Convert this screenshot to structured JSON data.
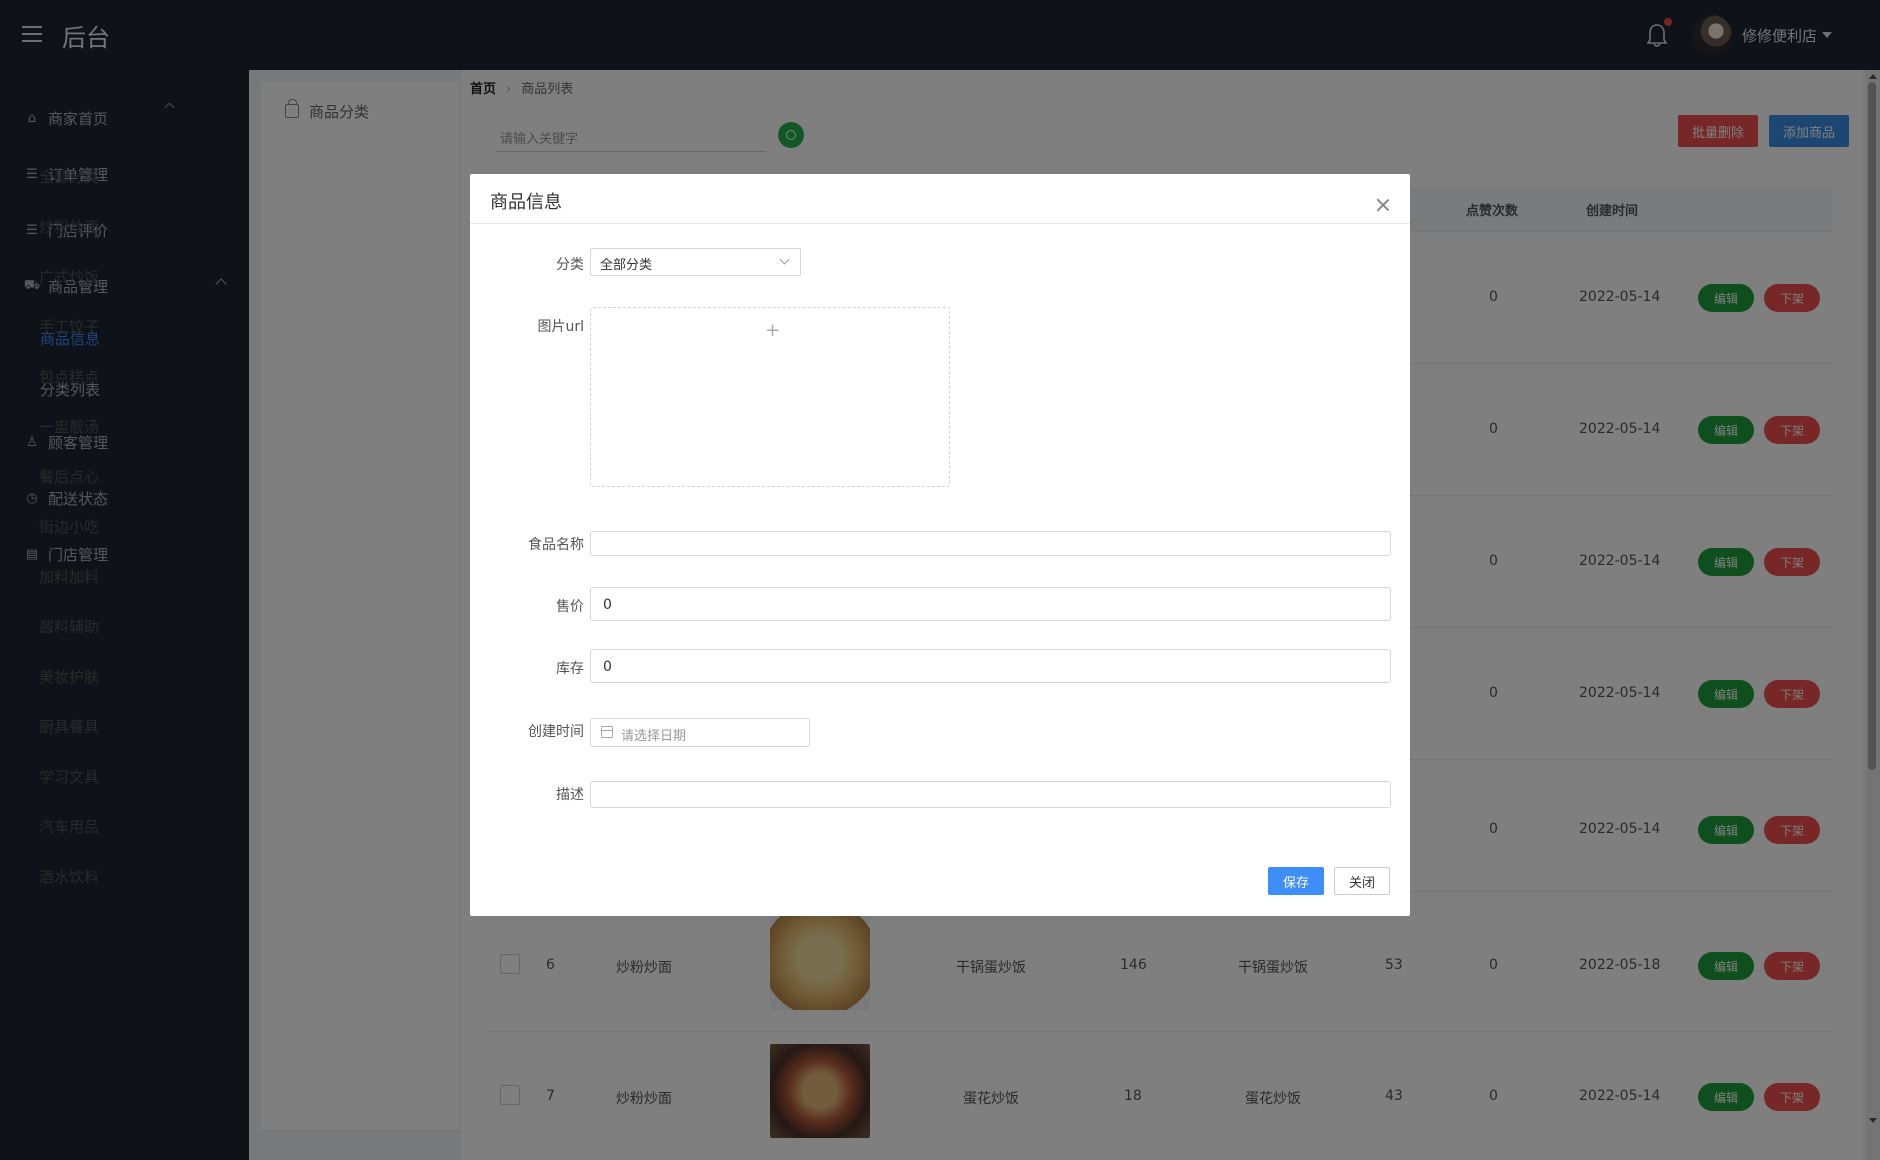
{
  "header": {
    "brand": "后台",
    "shop_name": "修修便利店"
  },
  "sidebar": {
    "items": [
      {
        "label": "商家首页",
        "icon": "home-icon"
      },
      {
        "label": "订单管理",
        "icon": "list-icon"
      },
      {
        "label": "门店评价",
        "icon": "list-icon"
      },
      {
        "label": "商品管理",
        "icon": "cart-icon"
      },
      {
        "label": "商品信息"
      },
      {
        "label": "分类列表"
      },
      {
        "label": "顾客管理",
        "icon": "user-icon"
      },
      {
        "label": "配送状态",
        "icon": "clock-icon"
      },
      {
        "label": "门店管理",
        "icon": "store-icon"
      }
    ]
  },
  "categories": {
    "title": "商品分类",
    "items": [
      "全部分类",
      "炒粉炒面",
      "广式炒饭",
      "手工饺子",
      "包点糕点",
      "一盅靓汤",
      "餐后点心",
      "街边小吃",
      "加料加料",
      "酱料辅助",
      "美妆护肤",
      "厨具餐具",
      "学习文具",
      "汽车用品",
      "酒水饮料"
    ]
  },
  "breadcrumb": {
    "home": "首页",
    "current": "商品列表"
  },
  "search": {
    "placeholder": "请输入关键字"
  },
  "toolbar": {
    "batch_delete": "批量删除",
    "add": "添加商品"
  },
  "table": {
    "headers": {
      "likes": "点赞次数",
      "created": "创建时间"
    },
    "rows": [
      {
        "likes": "0",
        "date": "2022-05-14"
      },
      {
        "likes": "0",
        "date": "2022-05-14"
      },
      {
        "likes": "0",
        "date": "2022-05-14"
      },
      {
        "likes": "0",
        "date": "2022-05-14"
      },
      {
        "likes": "0",
        "date": "2022-05-14"
      },
      {
        "id": "6",
        "category": "炒粉炒面",
        "name": "干锅蛋炒饭",
        "price": "146",
        "desc": "干锅蛋炒饭",
        "stock": "53",
        "likes": "0",
        "date": "2022-05-18"
      },
      {
        "id": "7",
        "category": "炒粉炒面",
        "name": "蛋花炒饭",
        "price": "18",
        "desc": "蛋花炒饭",
        "stock": "43",
        "likes": "0",
        "date": "2022-05-14"
      }
    ],
    "edit_label": "编辑",
    "offline_label": "下架"
  },
  "dialog": {
    "title": "商品信息",
    "labels": {
      "category": "分类",
      "image": "图片url",
      "name": "食品名称",
      "price": "售价",
      "stock": "库存",
      "created": "创建时间",
      "desc": "描述"
    },
    "category_value": "全部分类",
    "price_value": "0",
    "stock_value": "0",
    "date_placeholder": "请选择日期",
    "save": "保存",
    "close": "关闭"
  }
}
